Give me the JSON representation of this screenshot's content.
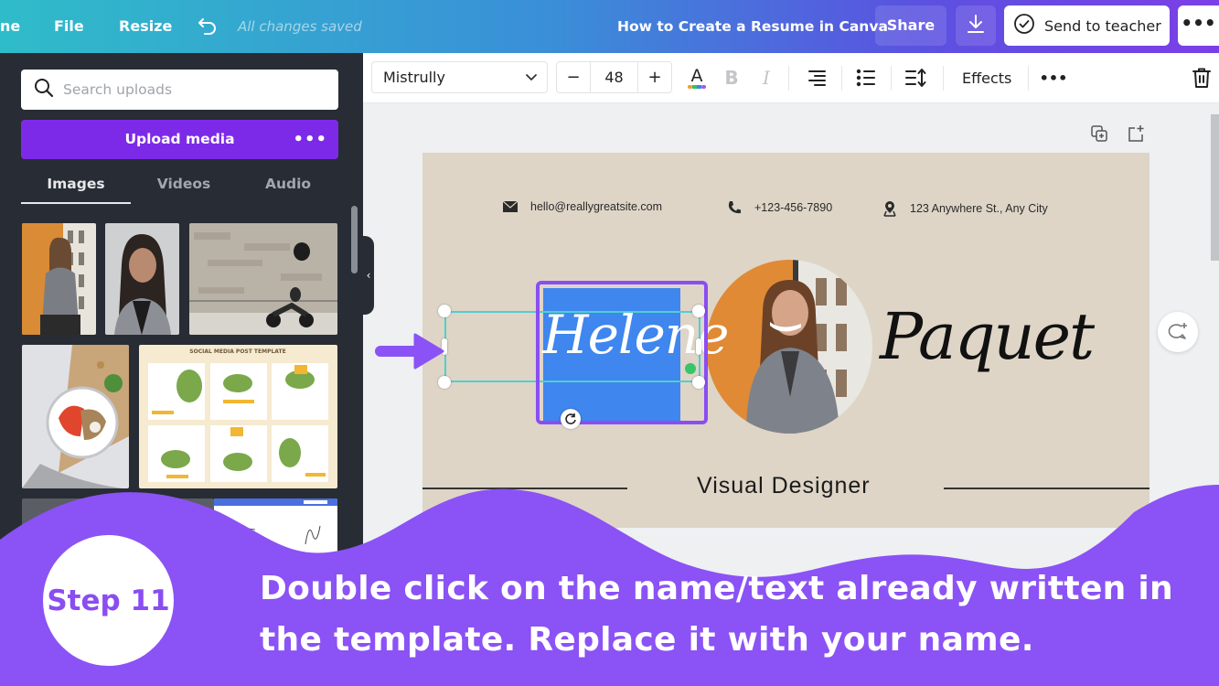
{
  "topbar": {
    "menu_home_partial": "ne",
    "menu_file": "File",
    "menu_resize": "Resize",
    "save_status": "All changes saved",
    "document_title": "How to Create a Resume in Canva",
    "share_label": "Share",
    "send_to_teacher_label": "Send to teacher",
    "more_label": "•••"
  },
  "sidebar": {
    "search_placeholder": "Search uploads",
    "upload_label": "Upload media",
    "upload_more": "•••",
    "tabs": [
      {
        "label": "Images",
        "active": true
      },
      {
        "label": "Videos",
        "active": false
      },
      {
        "label": "Audio",
        "active": false
      }
    ],
    "thumbnails": [
      {
        "subject": "woman seated by orange wall"
      },
      {
        "subject": "woman portrait in grey blazer"
      },
      {
        "subject": "scooter rider by stone wall"
      },
      {
        "subject": "salad plate on board"
      },
      {
        "subject": "social media post template"
      },
      {
        "subject": "canva screenshot"
      },
      {
        "subject": "canva editor screenshot"
      }
    ],
    "template_thumb_title": "SOCIAL MEDIA POST TEMPLATE",
    "collapse_icon": "‹"
  },
  "toolbar": {
    "font_name": "Mistrully",
    "font_size": "48",
    "decrease_label": "−",
    "increase_label": "+",
    "bold_label": "B",
    "italic_label": "I",
    "effects_label": "Effects",
    "more_label": "•••",
    "text_color_letter": "A"
  },
  "design": {
    "email": "hello@reallygreatsite.com",
    "phone": "+123-456-7890",
    "address": "123 Anywhere St., Any City",
    "first_name": "Helene",
    "last_name": "Paquet",
    "role": "Visual Designer"
  },
  "tutorial": {
    "step_label": "Step 11",
    "instruction_line1": "Double click on the name/text already written in",
    "instruction_line2": "the template. Replace it with your name."
  },
  "colors": {
    "accent_purple": "#8b52f5",
    "upload_purple": "#7d2ae8",
    "selection_blue": "#3f86ee",
    "page_beige": "#ded5c7",
    "panel_dark": "#282c34"
  }
}
